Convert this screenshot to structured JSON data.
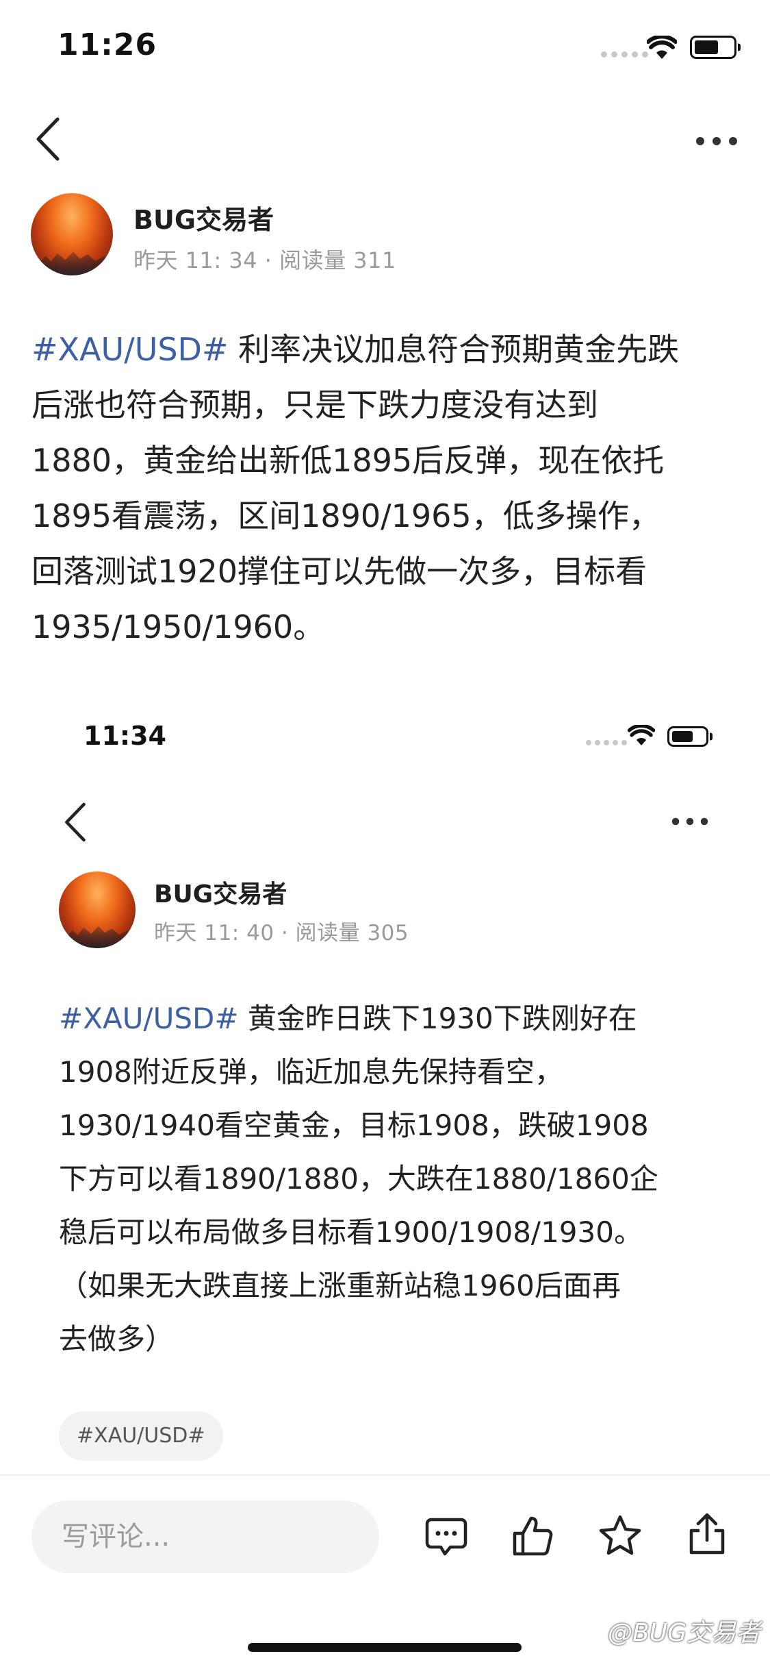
{
  "screen1": {
    "status": {
      "time": "11:26"
    },
    "author": {
      "name": "BUG交易者",
      "meta": "昨天 11: 34 · 阅读量 311"
    },
    "post": {
      "tag": "#XAU/USD#",
      "lines": [
        " 利率决议加息符合预期黄金先跌",
        "后涨也符合预期，只是下跌力度没有达到",
        "1880，黄金给出新低1895后反弹，现在依托",
        "1895看震荡，区间1890/1965，低多操作，",
        "回落测试1920撑住可以先做一次多，目标看",
        "1935/1950/1960。"
      ]
    }
  },
  "screen2": {
    "status": {
      "time": "11:34"
    },
    "author": {
      "name": "BUG交易者",
      "meta": "昨天 11: 40 · 阅读量 305"
    },
    "post": {
      "tag": "#XAU/USD#",
      "lines": [
        " 黄金昨日跌下1930下跌刚好在",
        "1908附近反弹，临近加息先保持看空，",
        "1930/1940看空黄金，目标1908，跌破1908",
        "下方可以看1890/1880，大跌在1880/1860企",
        "稳后可以布局做多目标看1900/1908/1930。",
        "（如果无大跌直接上涨重新站稳1960后面再",
        "去做多）"
      ]
    },
    "topic_chip": "#XAU/USD#"
  },
  "bottom_bar": {
    "comment_placeholder": "写评论...",
    "icons": [
      "comment-icon",
      "like-icon",
      "star-icon",
      "share-icon"
    ]
  },
  "watermark": "@BUG交易者",
  "colors": {
    "tag": "#3d5fa3",
    "meta": "#9a9a9a",
    "text": "#222222"
  }
}
